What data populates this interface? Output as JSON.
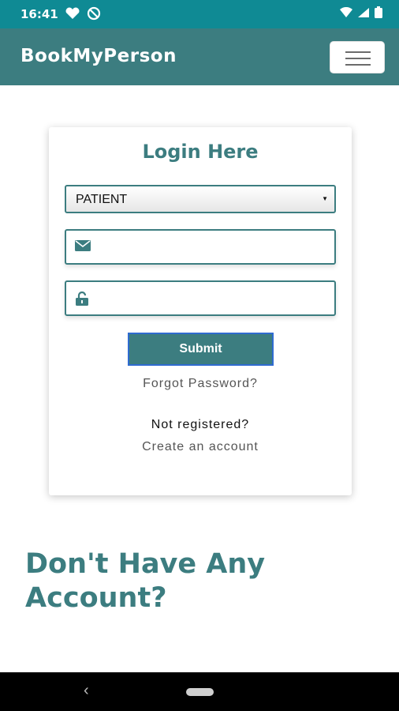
{
  "status_bar": {
    "time": "16:41",
    "left_icons": [
      "heart-icon",
      "no-notification-icon"
    ],
    "right_icons": [
      "wifi-icon",
      "signal-icon",
      "battery-icon"
    ]
  },
  "navbar": {
    "brand": "BookMyPerson",
    "toggle_icon": "hamburger-icon"
  },
  "login": {
    "title": "Login Here",
    "role_select": {
      "selected": "PATIENT"
    },
    "email_field": {
      "icon": "envelope-icon",
      "value": ""
    },
    "password_field": {
      "icon": "unlock-icon",
      "value": ""
    },
    "submit_label": "Submit",
    "forgot_label": "Forgot Password?",
    "not_registered": "Not registered?",
    "create_account": "Create an account"
  },
  "promo": {
    "heading": "Don't Have Any Account?"
  },
  "colors": {
    "status_bar": "#0f8a94",
    "primary": "#3c7d80",
    "button_border": "#2f6bd0"
  }
}
